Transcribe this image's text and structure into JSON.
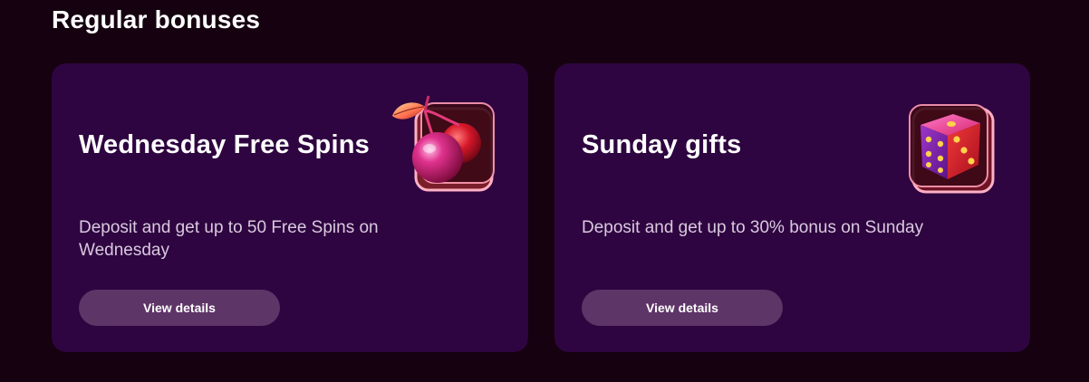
{
  "section": {
    "title": "Regular bonuses"
  },
  "cards": [
    {
      "title": "Wednesday Free Spins",
      "description": "Deposit and get up to 50 Free Spins on Wednesday",
      "button_label": "View details",
      "icon": "cherry-icon"
    },
    {
      "title": "Sunday gifts",
      "description": "Deposit and get up to 30% bonus on Sunday",
      "button_label": "View details",
      "icon": "dice-icon"
    }
  ],
  "colors": {
    "page_background": "#15010f",
    "card_background": "#2e0540",
    "button_background": "#5e3567",
    "description_text": "#d9c9df",
    "icon_glow": "#ff8ab0"
  }
}
